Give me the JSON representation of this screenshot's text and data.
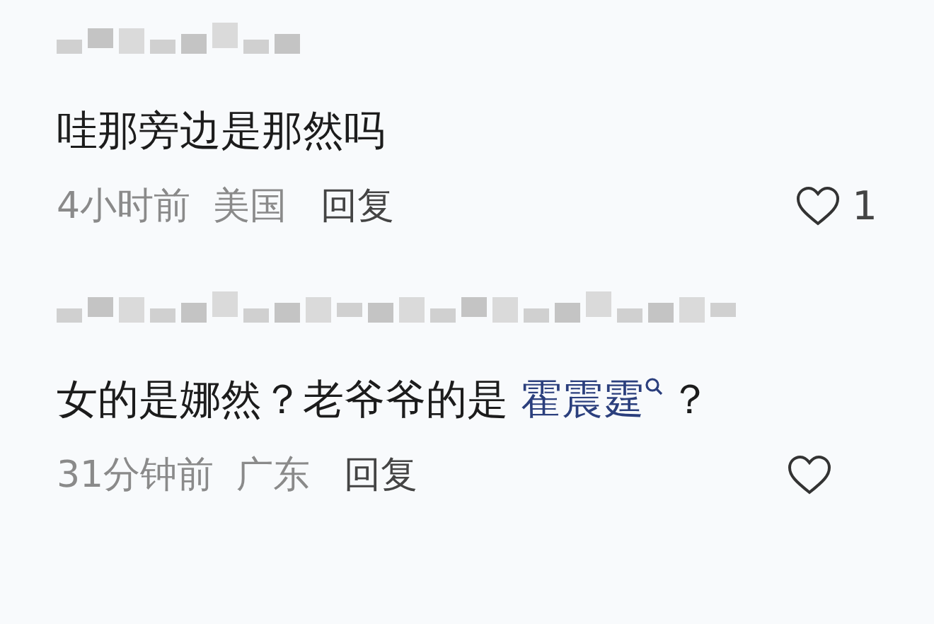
{
  "comments": [
    {
      "username": {
        "blurred": true
      },
      "body_parts": [
        {
          "kind": "text",
          "text": "哇那旁边是那然吗"
        }
      ],
      "time": "4小时前",
      "location": "美国",
      "reply": "回复",
      "like_count": "1"
    },
    {
      "username": {
        "blurred": true
      },
      "body_parts": [
        {
          "kind": "text",
          "text": "女的是娜然？老爷爷的是 "
        },
        {
          "kind": "link",
          "text": "霍震霆"
        },
        {
          "kind": "text",
          "text": "？"
        }
      ],
      "time": "31分钟前",
      "location": "广东",
      "reply": "回复"
    }
  ]
}
